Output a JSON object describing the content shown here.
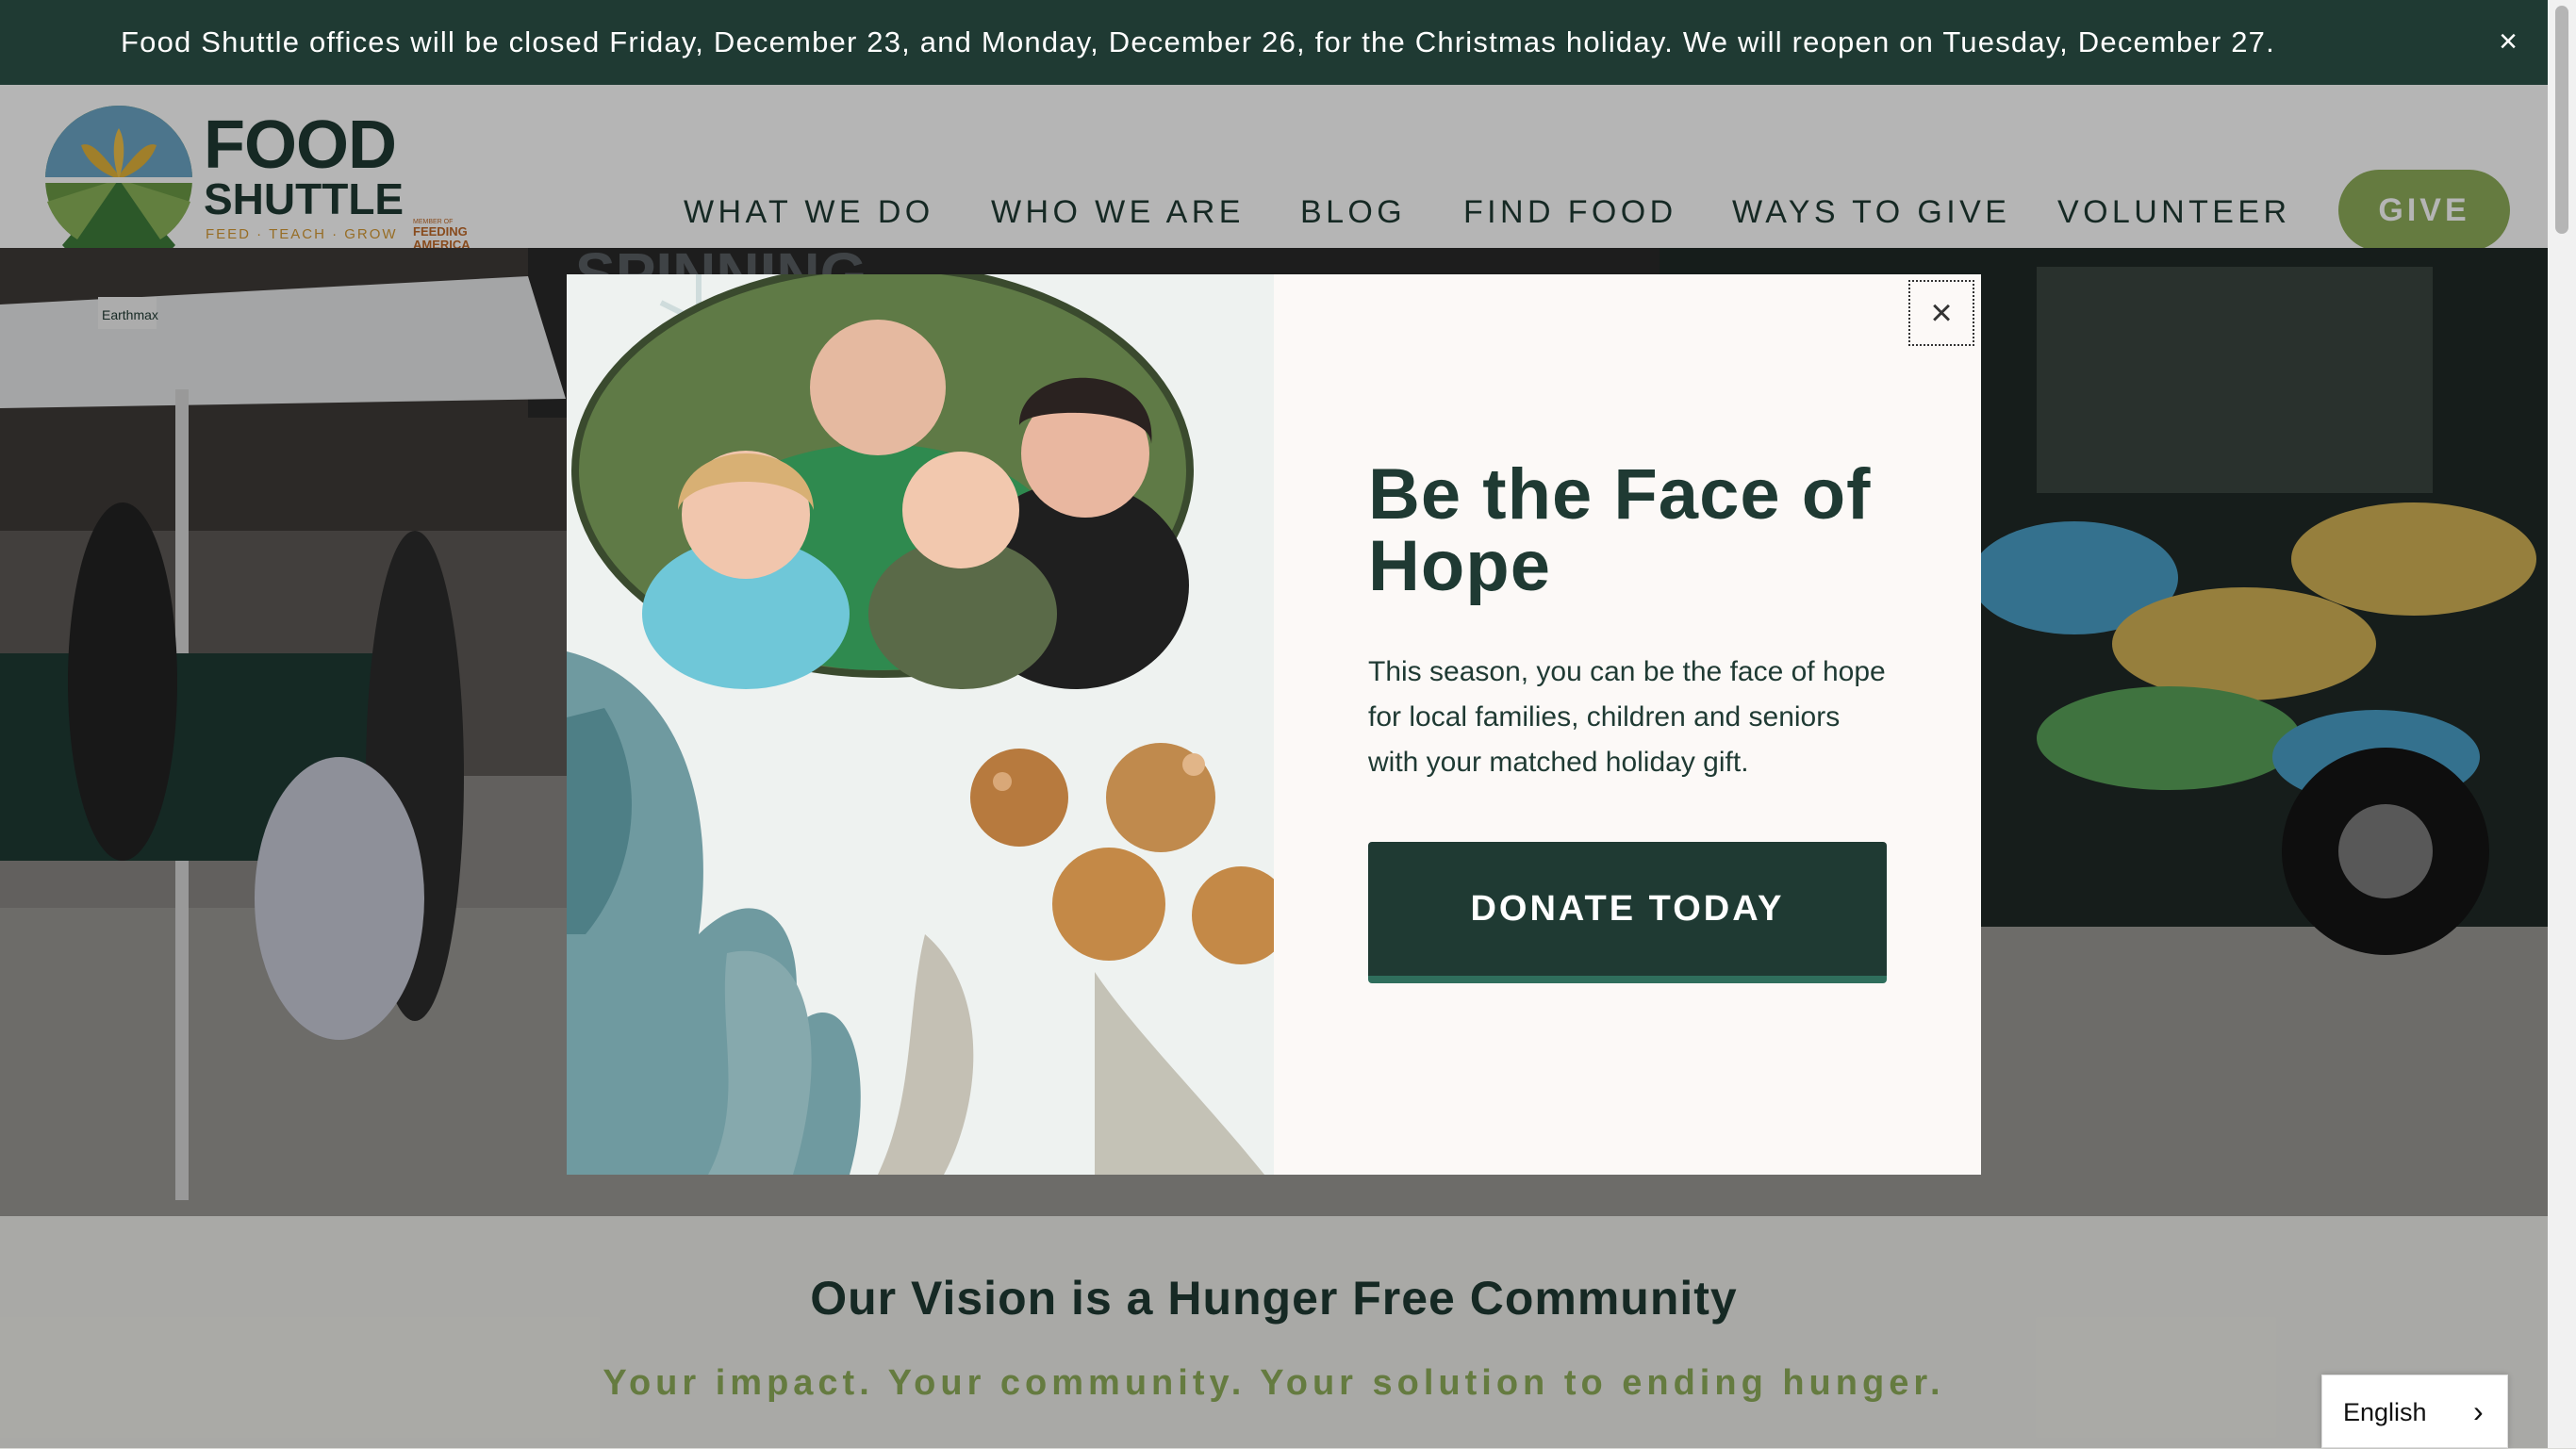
{
  "announcement": {
    "text": "Food Shuttle offices will  be closed Friday, December 23, and Monday, December 26, for the Christmas holiday. We will reopen on Tuesday, December 27.",
    "close_icon": "close-icon",
    "close_glyph": "×"
  },
  "logo": {
    "word1": "FOOD",
    "word2": "SHUTTLE",
    "tagline": "FEED · TEACH · GROW",
    "partner_small": "MEMBER OF",
    "partner": "FEEDING AMERICA"
  },
  "nav": {
    "items": [
      {
        "label": "WHAT WE DO"
      },
      {
        "label": "WHO WE ARE"
      },
      {
        "label": "BLOG"
      },
      {
        "label": "FIND FOOD"
      },
      {
        "label": "WAYS TO GIVE"
      },
      {
        "label": "VOLUNTEER"
      }
    ],
    "give_label": "GIVE"
  },
  "hero": {
    "tent_sign": "Earthmax",
    "banner_text": "SPINNING"
  },
  "vision": {
    "title": "Our Vision is a Hunger Free Community",
    "subtitle": "Your impact. Your community. Your solution to ending hunger."
  },
  "modal": {
    "close_glyph": "×",
    "heading": "Be the Face of Hope",
    "body": "This season, you can be the face of hope for local families, children and seniors with your matched holiday gift.",
    "cta_label": "DONATE TODAY"
  },
  "language": {
    "selected": "English",
    "chevron": "›"
  },
  "colors": {
    "brand_dark": "#1f3a33",
    "brand_green": "#8fae5b",
    "accent_teal": "#2f6e5c",
    "accent_gold": "#d59a35"
  }
}
